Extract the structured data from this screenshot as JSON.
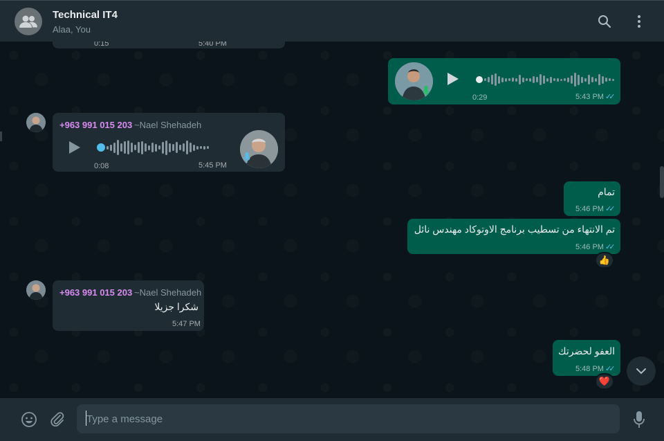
{
  "header": {
    "title": "Technical IT4",
    "subtitle": "Alaa, You",
    "search_icon": "search-icon",
    "menu_icon": "more-vertical-icon"
  },
  "messages": {
    "partial_top": {
      "duration": "0:15",
      "time": "5:40 PM"
    },
    "voice_out": {
      "duration": "0:29",
      "time": "5:43 PM",
      "status": "read"
    },
    "voice_in": {
      "phone": "+963 991 015 203",
      "name": "~Nael Shehadeh",
      "duration": "0:08",
      "time": "5:45 PM"
    },
    "text_out_1": {
      "text": "تمام",
      "time": "5:46 PM"
    },
    "text_out_2": {
      "text": "تم الانتهاء من تسطيب برنامج الاوتوكاد مهندس نائل",
      "time": "5:46 PM",
      "reaction": "👍"
    },
    "text_in": {
      "phone": "+963 991 015 203",
      "name": "~Nael Shehadeh",
      "text": "شكرا جزيلا",
      "time": "5:47 PM"
    },
    "text_out_3": {
      "text": "العفو لحضرتك",
      "time": "5:48 PM",
      "reaction": "❤️"
    }
  },
  "footer": {
    "placeholder": "Type a message",
    "emoji_icon": "emoji-icon",
    "attach_icon": "attach-icon",
    "mic_icon": "mic-icon"
  },
  "colors": {
    "header_bg": "#202c33",
    "chat_bg": "#0b141a",
    "bubble_in": "#202c33",
    "bubble_out": "#005c4b",
    "sender_phone": "#d88bf0",
    "read_ticks": "#53bdeb"
  }
}
